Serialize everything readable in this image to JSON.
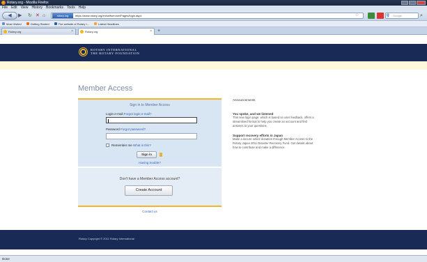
{
  "window": {
    "title": "Rotary.org - Mozilla Firefox"
  },
  "menu": [
    "File",
    "Edit",
    "View",
    "History",
    "Bookmarks",
    "Tools",
    "Help"
  ],
  "navbar": {
    "site_identity": "rotary.org",
    "url": "https://www.rotary.org/en/selfservice/Pages/login.aspx",
    "search_placeholder": "Google"
  },
  "bookmarks": [
    "Most Visited",
    "Getting Started",
    "The website of Rotary I...",
    "Latest Headlines"
  ],
  "tabs": [
    {
      "label": "Rotary.org",
      "active": false
    },
    {
      "label": "Rotary.org",
      "active": true
    }
  ],
  "header": {
    "brand_line1": "ROTARY INTERNATIONAL",
    "brand_line2": "THE ROTARY FOUNDATION"
  },
  "page": {
    "title": "Member Access"
  },
  "login": {
    "heading": "Sign in to Member Access",
    "email_label": "Login e-mail",
    "email_help": "Forgot login e-mail?",
    "password_label": "Password",
    "password_help": "Forgot password?",
    "remember_label": "Remember me",
    "remember_help": "What is this?",
    "signin_button": "Sign in",
    "help_link": "Having trouble?"
  },
  "create": {
    "question": "Don't have a Member Access account?",
    "button": "Create Account"
  },
  "contact_link": "Contact us",
  "announcements": {
    "title": "Announcements",
    "items": [
      {
        "heading": "You spoke, and we listened",
        "body": "This new login page, which is based on user feedback, offers a streamlined format to help you create an account and find answers to your questions."
      },
      {
        "heading": "Support recovery efforts in Japan",
        "body": "Make a secure online donation through Member Access to the Rotary Japan 2011 Disaster Recovery Fund. Get details about how to contribute and make a difference."
      }
    ]
  },
  "footer": {
    "copyright": "Rotary Copyright © 2011 Rotary International"
  },
  "status": {
    "text": "Done"
  }
}
